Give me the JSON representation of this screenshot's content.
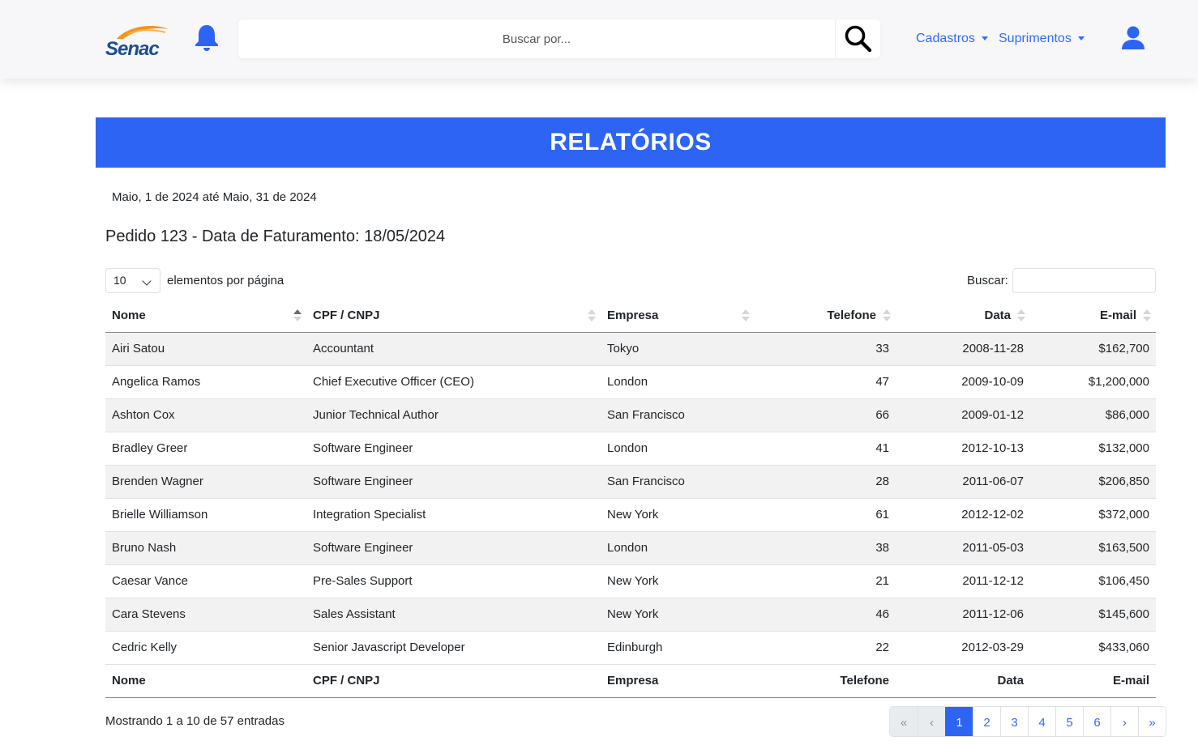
{
  "header": {
    "logo_text": "Senac",
    "search_placeholder": "Buscar por...",
    "menus": [
      {
        "label": "Cadastros"
      },
      {
        "label": "Suprimentos"
      }
    ]
  },
  "page_title": "RELATÓRIOS",
  "date_range": "Maio, 1 de 2024 até Maio, 31 de 2024",
  "order_title": "Pedido 123 - Data de Faturamento: 18/05/2024",
  "controls": {
    "page_length_value": "10",
    "page_length_label": "elementos por página",
    "filter_label": "Buscar:"
  },
  "table": {
    "columns": [
      "Nome",
      "CPF / CNPJ",
      "Empresa",
      "Telefone",
      "Data",
      "E-mail"
    ],
    "rows": [
      [
        "Airi Satou",
        "Accountant",
        "Tokyo",
        "33",
        "2008-11-28",
        "$162,700"
      ],
      [
        "Angelica Ramos",
        "Chief Executive Officer (CEO)",
        "London",
        "47",
        "2009-10-09",
        "$1,200,000"
      ],
      [
        "Ashton Cox",
        "Junior Technical Author",
        "San Francisco",
        "66",
        "2009-01-12",
        "$86,000"
      ],
      [
        "Bradley Greer",
        "Software Engineer",
        "London",
        "41",
        "2012-10-13",
        "$132,000"
      ],
      [
        "Brenden Wagner",
        "Software Engineer",
        "San Francisco",
        "28",
        "2011-06-07",
        "$206,850"
      ],
      [
        "Brielle Williamson",
        "Integration Specialist",
        "New York",
        "61",
        "2012-12-02",
        "$372,000"
      ],
      [
        "Bruno Nash",
        "Software Engineer",
        "London",
        "38",
        "2011-05-03",
        "$163,500"
      ],
      [
        "Caesar Vance",
        "Pre-Sales Support",
        "New York",
        "21",
        "2011-12-12",
        "$106,450"
      ],
      [
        "Cara Stevens",
        "Sales Assistant",
        "New York",
        "46",
        "2011-12-06",
        "$145,600"
      ],
      [
        "Cedric Kelly",
        "Senior Javascript Developer",
        "Edinburgh",
        "22",
        "2012-03-29",
        "$433,060"
      ]
    ]
  },
  "info": "Mostrando 1 a 10 de 57 entradas",
  "pagination": {
    "first": "«",
    "prev": "‹",
    "pages": [
      "1",
      "2",
      "3",
      "4",
      "5",
      "6"
    ],
    "active": "1",
    "next": "›",
    "last": "»"
  },
  "colors": {
    "primary": "#2e64f4",
    "link": "#2f6bff",
    "logo_orange": "#f7941d",
    "logo_blue": "#1b4e8c"
  }
}
